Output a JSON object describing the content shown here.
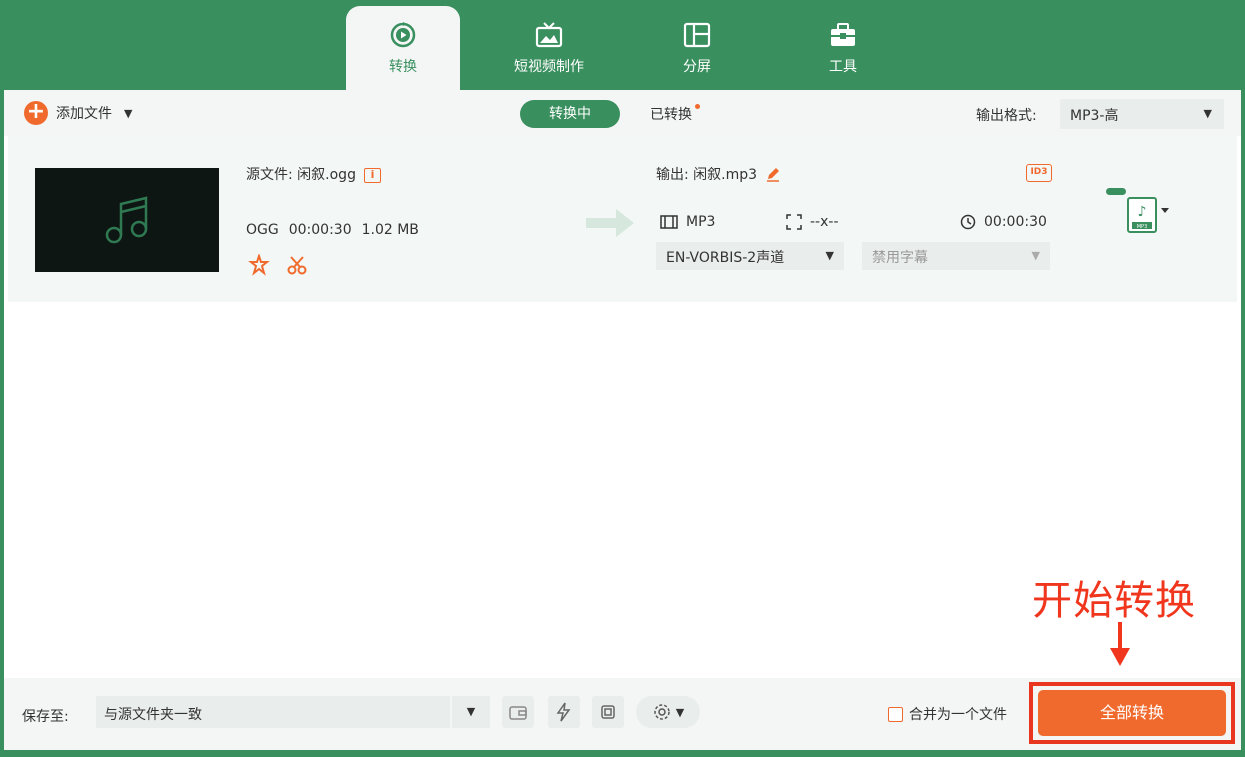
{
  "tabs": [
    {
      "label": "转换",
      "icon": "convert-icon",
      "active": true
    },
    {
      "label": "短视频制作",
      "icon": "video-tv-icon",
      "active": false
    },
    {
      "label": "分屏",
      "icon": "split-screen-icon",
      "active": false
    },
    {
      "label": "工具",
      "icon": "toolbox-icon",
      "active": false
    }
  ],
  "toolbar": {
    "add_file": "添加文件",
    "converting": "转换中",
    "converted": "已转换",
    "output_format_label": "输出格式:",
    "output_format_value": "MP3-高"
  },
  "file": {
    "source_label": "源文件: 闲叙.ogg",
    "source_format": "OGG",
    "duration": "00:00:30",
    "size": "1.02 MB",
    "output_label": "输出: 闲叙.mp3",
    "output_format": "MP3",
    "resolution": "--x--",
    "output_duration": "00:00:30",
    "audio_track": "EN-VORBIS-2声道",
    "subtitle": "禁用字幕",
    "badge_id3": "ID3",
    "fmt_badge": "MP3"
  },
  "footer": {
    "save_label": "保存至:",
    "save_path": "与源文件夹一致",
    "merge_label": "合并为一个文件",
    "convert_all": "全部转换"
  },
  "annotation": {
    "text": "开始转换",
    "color": "#f0361d"
  },
  "colors": {
    "brand_green": "#3a8f5f",
    "accent_orange": "#f06a2d"
  }
}
